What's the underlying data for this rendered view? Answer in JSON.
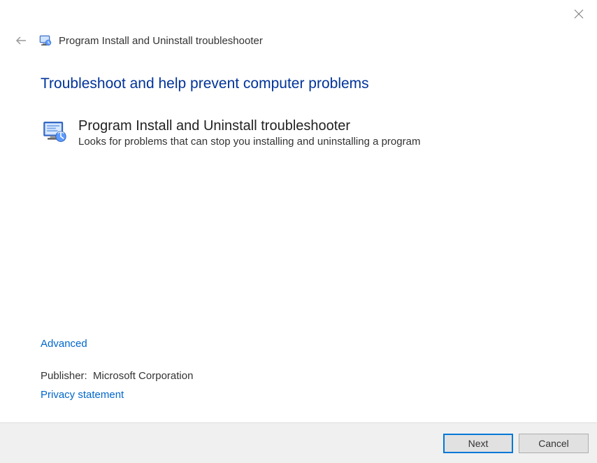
{
  "window": {
    "title": "Program Install and Uninstall troubleshooter"
  },
  "main": {
    "heading": "Troubleshoot and help prevent computer problems",
    "troubleshooter": {
      "title": "Program Install and Uninstall troubleshooter",
      "description": "Looks for problems that can stop you installing and uninstalling a program"
    }
  },
  "links": {
    "advanced": "Advanced",
    "privacy": "Privacy statement"
  },
  "publisher": {
    "label": "Publisher:",
    "value": "Microsoft Corporation"
  },
  "footer": {
    "next": "Next",
    "cancel": "Cancel"
  },
  "colors": {
    "heading": "#003399",
    "link": "#0066cc",
    "primary_border": "#0078d7"
  }
}
